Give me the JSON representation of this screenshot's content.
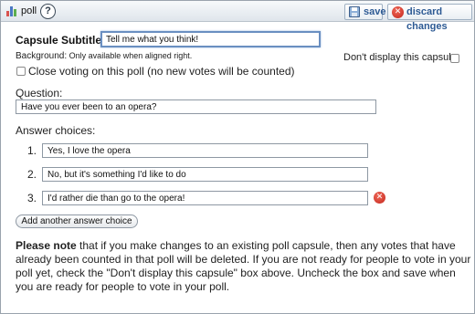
{
  "toolbar": {
    "title": "poll",
    "help_glyph": "?",
    "save_label": "save",
    "discard_label": "discard changes"
  },
  "icons": {
    "poll": "bar-chart-icon",
    "help": "help-icon",
    "save": "floppy-disk-icon",
    "discard": "close-circle-icon",
    "delete_choice": "close-circle-icon"
  },
  "colors": {
    "accent": "#2d5a94",
    "delete": "#c3251b",
    "focus_border": "#6a8fc1"
  },
  "subtitle": {
    "label": "Capsule Subtitle:",
    "value": "Tell me what you think!"
  },
  "background": {
    "label": "Background:",
    "note": "Only available when aligned right."
  },
  "dont_display": {
    "label": "Don't display this capsule:",
    "checked": false
  },
  "close_voting": {
    "label": "Close voting on this poll (no new votes will be counted)",
    "checked": false
  },
  "question": {
    "label": "Question:",
    "value": "Have you ever been to an opera?"
  },
  "answers": {
    "label": "Answer choices:",
    "items": [
      {
        "number": "1.",
        "value": "Yes, I love the opera"
      },
      {
        "number": "2.",
        "value": "No, but it's something I'd like to do"
      },
      {
        "number": "3.",
        "value": "I'd rather die than go to the opera!"
      }
    ],
    "delete_glyph": "✕"
  },
  "add_choice_label": "Add another answer choice",
  "note": {
    "bold": "Please note",
    "text": " that if you make changes to an existing poll capsule, then any votes that have already been counted in that poll will be deleted. If you are not ready for people to vote in your poll yet, check the \"Don't display this capsule\" box above. Uncheck the box and save when you are ready for people to vote in your poll."
  }
}
